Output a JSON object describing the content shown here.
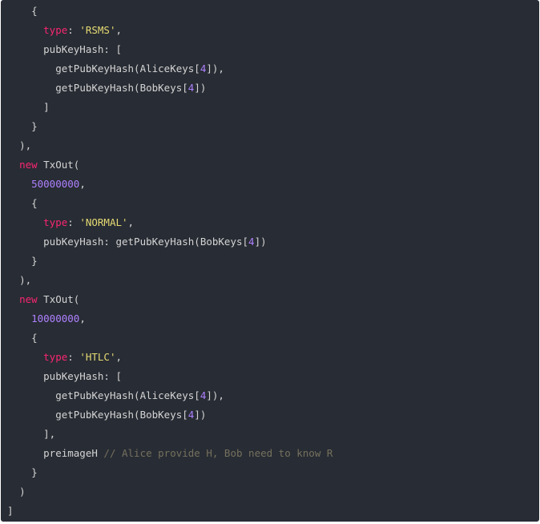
{
  "code_lines": [
    [
      [
        "    ",
        "plain"
      ],
      [
        "{",
        "plain"
      ]
    ],
    [
      [
        "      ",
        "plain"
      ],
      [
        "type",
        "kw"
      ],
      [
        ": ",
        "plain"
      ],
      [
        "'RSMS'",
        "str"
      ],
      [
        ",",
        "plain"
      ]
    ],
    [
      [
        "      ",
        "plain"
      ],
      [
        "pubKeyHash: [",
        "plain"
      ]
    ],
    [
      [
        "        ",
        "plain"
      ],
      [
        "getPubKeyHash(AliceKeys[",
        "plain"
      ],
      [
        "4",
        "num"
      ],
      [
        "]),",
        "plain"
      ]
    ],
    [
      [
        "        ",
        "plain"
      ],
      [
        "getPubKeyHash(BobKeys[",
        "plain"
      ],
      [
        "4",
        "num"
      ],
      [
        "])",
        "plain"
      ]
    ],
    [
      [
        "      ",
        "plain"
      ],
      [
        "]",
        "plain"
      ]
    ],
    [
      [
        "    ",
        "plain"
      ],
      [
        "}",
        "plain"
      ]
    ],
    [
      [
        "  ",
        "plain"
      ],
      [
        "),",
        "plain"
      ]
    ],
    [
      [
        "  ",
        "plain"
      ],
      [
        "new",
        "kw"
      ],
      [
        " TxOut(",
        "plain"
      ]
    ],
    [
      [
        "    ",
        "plain"
      ],
      [
        "50000000",
        "num"
      ],
      [
        ",",
        "plain"
      ]
    ],
    [
      [
        "    ",
        "plain"
      ],
      [
        "{",
        "plain"
      ]
    ],
    [
      [
        "      ",
        "plain"
      ],
      [
        "type",
        "kw"
      ],
      [
        ": ",
        "plain"
      ],
      [
        "'NORMAL'",
        "str"
      ],
      [
        ",",
        "plain"
      ]
    ],
    [
      [
        "      ",
        "plain"
      ],
      [
        "pubKeyHash: getPubKeyHash(BobKeys[",
        "plain"
      ],
      [
        "4",
        "num"
      ],
      [
        "])",
        "plain"
      ]
    ],
    [
      [
        "    ",
        "plain"
      ],
      [
        "}",
        "plain"
      ]
    ],
    [
      [
        "  ",
        "plain"
      ],
      [
        "),",
        "plain"
      ]
    ],
    [
      [
        "  ",
        "plain"
      ],
      [
        "new",
        "kw"
      ],
      [
        " TxOut(",
        "plain"
      ]
    ],
    [
      [
        "    ",
        "plain"
      ],
      [
        "10000000",
        "num"
      ],
      [
        ",",
        "plain"
      ]
    ],
    [
      [
        "    ",
        "plain"
      ],
      [
        "{",
        "plain"
      ]
    ],
    [
      [
        "      ",
        "plain"
      ],
      [
        "type",
        "kw"
      ],
      [
        ": ",
        "plain"
      ],
      [
        "'HTLC'",
        "str"
      ],
      [
        ",",
        "plain"
      ]
    ],
    [
      [
        "      ",
        "plain"
      ],
      [
        "pubKeyHash: [",
        "plain"
      ]
    ],
    [
      [
        "        ",
        "plain"
      ],
      [
        "getPubKeyHash(AliceKeys[",
        "plain"
      ],
      [
        "4",
        "num"
      ],
      [
        "]),",
        "plain"
      ]
    ],
    [
      [
        "        ",
        "plain"
      ],
      [
        "getPubKeyHash(BobKeys[",
        "plain"
      ],
      [
        "4",
        "num"
      ],
      [
        "])",
        "plain"
      ]
    ],
    [
      [
        "      ",
        "plain"
      ],
      [
        "],",
        "plain"
      ]
    ],
    [
      [
        "      ",
        "plain"
      ],
      [
        "preimageH ",
        "plain"
      ],
      [
        "// Alice provide H, Bob need to know R",
        "cm"
      ]
    ],
    [
      [
        "    ",
        "plain"
      ],
      [
        "}",
        "plain"
      ]
    ],
    [
      [
        "  ",
        "plain"
      ],
      [
        ")",
        "plain"
      ]
    ],
    [
      [
        "",
        "plain"
      ],
      [
        "]",
        "plain"
      ]
    ]
  ],
  "colors": {
    "background": "#282c34",
    "keyword": "#f92672",
    "string": "#e6db74",
    "number": "#ae81ff",
    "comment": "#75715e",
    "plain": "#d4d4d4"
  }
}
